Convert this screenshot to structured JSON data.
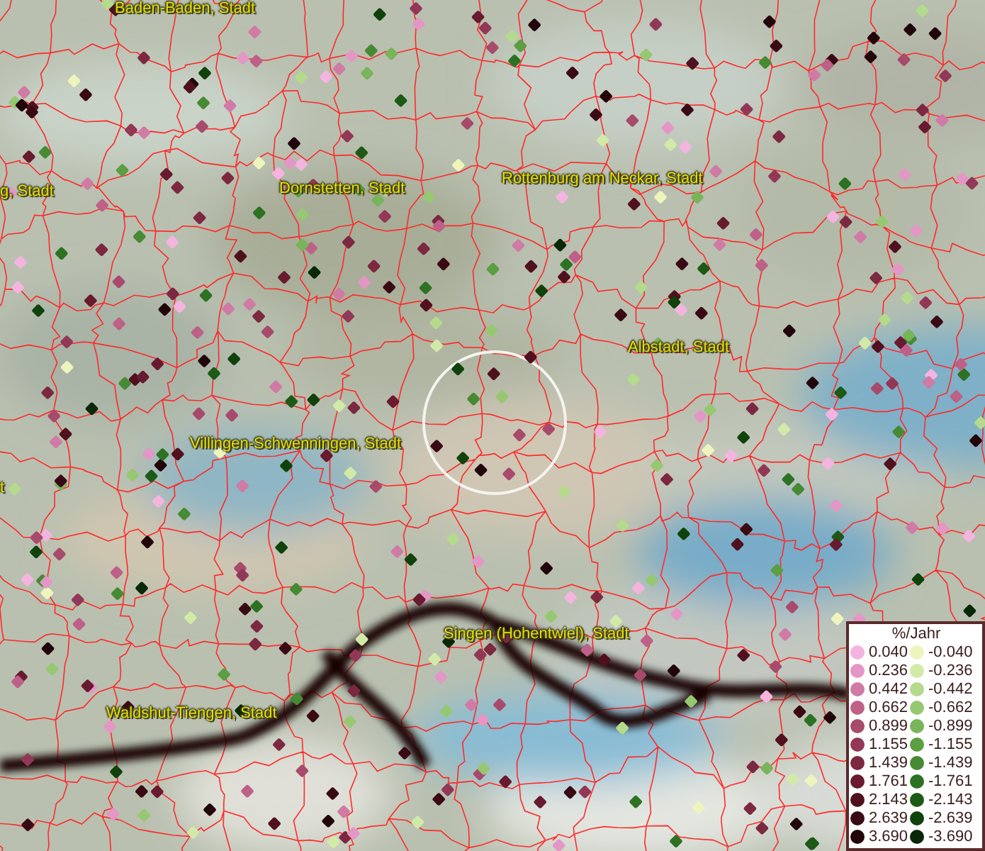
{
  "map": {
    "labels": [
      {
        "text": "Baden-Baden, Stadt"
      },
      {
        "text": "g, Stadt"
      },
      {
        "text": "Dornstetten, Stadt"
      },
      {
        "text": "Rottenburg am Neckar, Stadt"
      },
      {
        "text": "Albstadt, Stadt"
      },
      {
        "text": "Villingen-Schwenningen, Stadt"
      },
      {
        "text": "t"
      },
      {
        "text": "Singen (Hohentwiel), Stadt"
      },
      {
        "text": "Waldshut-Tiengen, Stadt"
      }
    ]
  },
  "legend": {
    "title": "%/Jahr",
    "items": [
      {
        "label": "0.040",
        "color": "#f4b4e0"
      },
      {
        "label": "-0.040",
        "color": "#eef5bc"
      },
      {
        "label": "0.236",
        "color": "#e496c6"
      },
      {
        "label": "-0.236",
        "color": "#d2eaa8"
      },
      {
        "label": "0.442",
        "color": "#d07aa6"
      },
      {
        "label": "-0.442",
        "color": "#b4da8c"
      },
      {
        "label": "0.662",
        "color": "#be6088"
      },
      {
        "label": "-0.662",
        "color": "#96c872"
      },
      {
        "label": "0.899",
        "color": "#a84a6c"
      },
      {
        "label": "-0.899",
        "color": "#78b45a"
      },
      {
        "label": "1.155",
        "color": "#923856"
      },
      {
        "label": "-1.155",
        "color": "#5c9e42"
      },
      {
        "label": "1.439",
        "color": "#7c2840"
      },
      {
        "label": "-1.439",
        "color": "#468a34"
      },
      {
        "label": "1.761",
        "color": "#681a2e"
      },
      {
        "label": "-1.761",
        "color": "#2c7222"
      },
      {
        "label": "2.143",
        "color": "#50101e"
      },
      {
        "label": "-2.143",
        "color": "#1c5a16"
      },
      {
        "label": "2.639",
        "color": "#3a0a14"
      },
      {
        "label": "-2.639",
        "color": "#10420c"
      },
      {
        "label": "3.690",
        "color": "#22050a"
      },
      {
        "label": "-3.690",
        "color": "#082806"
      }
    ]
  }
}
